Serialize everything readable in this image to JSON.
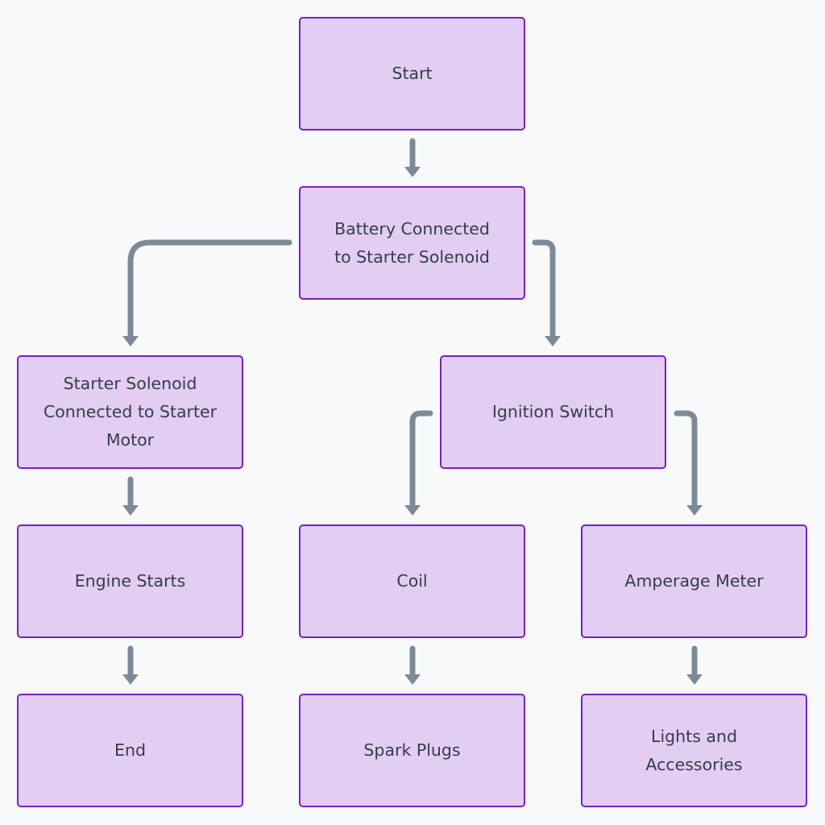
{
  "diagram": {
    "type": "flowchart",
    "colors": {
      "background": "#f8f9fb",
      "node_fill": "#e3cdf3",
      "node_border": "#7a1fc4",
      "text": "#333d4b",
      "edge": "#7c8a98"
    },
    "nodes": [
      {
        "id": "start",
        "label": "Start"
      },
      {
        "id": "battery",
        "label": "Battery Connected to Starter Solenoid"
      },
      {
        "id": "solenoid",
        "label": "Starter Solenoid Connected to Starter Motor"
      },
      {
        "id": "ignition",
        "label": "Ignition Switch"
      },
      {
        "id": "engine",
        "label": "Engine Starts"
      },
      {
        "id": "coil",
        "label": "Coil"
      },
      {
        "id": "amp",
        "label": "Amperage Meter"
      },
      {
        "id": "end",
        "label": "End"
      },
      {
        "id": "spark",
        "label": "Spark Plugs"
      },
      {
        "id": "lights",
        "label": "Lights and Accessories"
      }
    ],
    "edges": [
      {
        "from": "start",
        "to": "battery"
      },
      {
        "from": "battery",
        "to": "solenoid"
      },
      {
        "from": "battery",
        "to": "ignition"
      },
      {
        "from": "solenoid",
        "to": "engine"
      },
      {
        "from": "ignition",
        "to": "coil"
      },
      {
        "from": "ignition",
        "to": "amp"
      },
      {
        "from": "engine",
        "to": "end"
      },
      {
        "from": "coil",
        "to": "spark"
      },
      {
        "from": "amp",
        "to": "lights"
      }
    ]
  }
}
